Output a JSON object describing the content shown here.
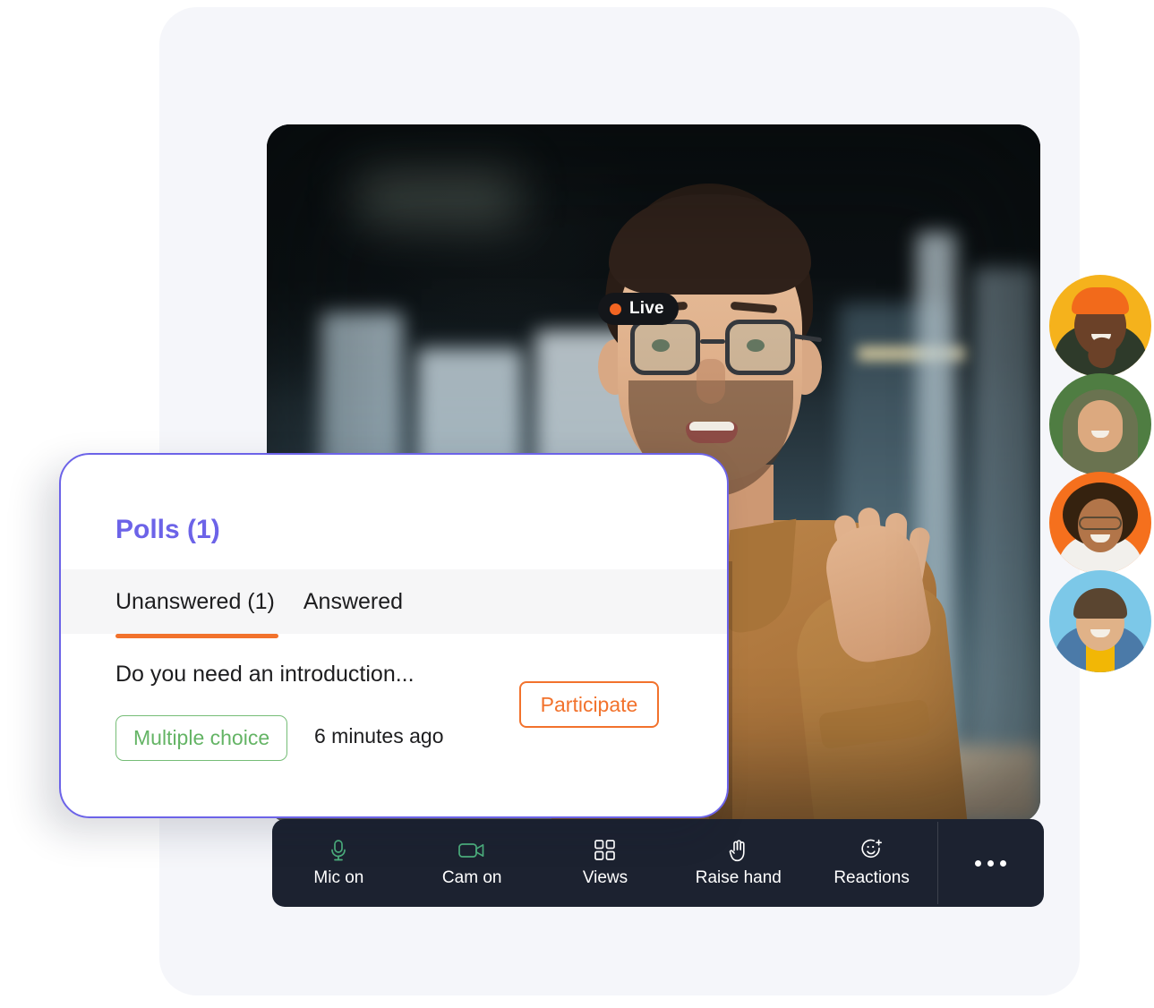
{
  "video": {
    "live_badge": {
      "label": "Live",
      "dot_color": "#f26522",
      "pill_color": "#14161a"
    }
  },
  "participants": [
    {
      "name": "participant-1",
      "bg_color": "#f5b21c"
    },
    {
      "name": "participant-2",
      "bg_color": "#4f7d42"
    },
    {
      "name": "participant-3",
      "bg_color": "#f5701d"
    },
    {
      "name": "participant-4",
      "bg_color": "#7cc8e8"
    }
  ],
  "toolbar": {
    "background": "#1c2230",
    "items": [
      {
        "label": "Mic on",
        "icon": "microphone-icon",
        "state_color": "#4caf7d"
      },
      {
        "label": "Cam on",
        "icon": "camera-icon",
        "state_color": "#4caf7d"
      },
      {
        "label": "Views",
        "icon": "grid-views-icon",
        "state_color": "#ffffff"
      },
      {
        "label": "Raise hand",
        "icon": "raise-hand-icon",
        "state_color": "#ffffff"
      },
      {
        "label": "Reactions",
        "icon": "reactions-icon",
        "state_color": "#ffffff"
      }
    ],
    "more_icon": "more-options-icon"
  },
  "polls_panel": {
    "title": "Polls (1)",
    "accent_color": "#6c63e8",
    "tabs": [
      {
        "label": "Unanswered (1)",
        "active": true
      },
      {
        "label": "Answered",
        "active": false
      }
    ],
    "active_tab_underline_color": "#f2722c",
    "poll": {
      "question": "Do you need an introduction...",
      "type_badge": "Multiple choice",
      "type_badge_color": "#64b465",
      "timestamp": "6 minutes ago",
      "action_label": "Participate",
      "action_color": "#f2722c"
    }
  }
}
